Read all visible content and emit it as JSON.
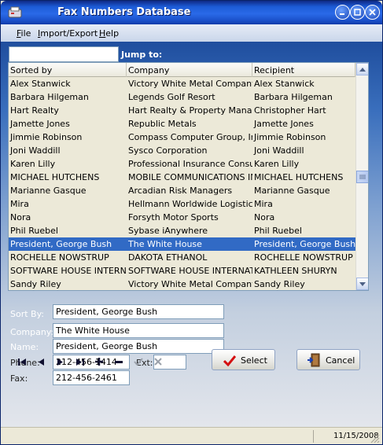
{
  "window": {
    "title": "Fax Numbers Database"
  },
  "menu": [
    {
      "underline": "F",
      "rest": "ile"
    },
    {
      "underline": "I",
      "rest": "mport/Export"
    },
    {
      "underline": "H",
      "rest": "elp"
    }
  ],
  "jump": {
    "label": "Jump to:",
    "value": ""
  },
  "grid": {
    "columns": [
      "Sorted by",
      "Company",
      "Recipient"
    ],
    "rows": [
      [
        "Alex Stanwick",
        "Victory White Metal Company",
        "Alex Stanwick"
      ],
      [
        "Barbara Hilgeman",
        "Legends Golf Resort",
        "Barbara Hilgeman"
      ],
      [
        "Hart Realty",
        "Hart Realty & Property Management",
        "Christopher Hart"
      ],
      [
        "Jamette Jones",
        "Republic Metals",
        "Jamette Jones"
      ],
      [
        "Jimmie Robinson",
        "Compass Computer Group, Inc.",
        "Jimmie Robinson"
      ],
      [
        "Joni Waddill",
        "Sysco Corporation",
        "Joni Waddill"
      ],
      [
        "Karen Lilly",
        "Professional Insurance Consultants",
        "Karen Lilly"
      ],
      [
        "MICHAEL HUTCHENS",
        "MOBILE COMMUNICATIONS INC.",
        "MICHAEL HUTCHENS"
      ],
      [
        "Marianne Gasque",
        "Arcadian Risk Managers",
        "Marianne Gasque"
      ],
      [
        "Mira",
        "Hellmann Worldwide Logistics",
        "Mira"
      ],
      [
        "Nora",
        "Forsyth Motor Sports",
        "Nora"
      ],
      [
        "Phil Ruebel",
        "Sybase iAnywhere",
        "Phil Ruebel"
      ],
      [
        "President, George Bush",
        "The White House",
        "President, George Bush"
      ],
      [
        "ROCHELLE NOWSTRUP",
        "DAKOTA ETHANOL",
        "ROCHELLE NOWSTRUP"
      ],
      [
        "SOFTWARE HOUSE INTERNATIONAL",
        "SOFTWARE HOUSE INTERNATIONAL",
        "KATHLEEN SHURYN"
      ],
      [
        "Sandy Riley",
        "Victory White Metal Company - C",
        "Sandy Riley"
      ]
    ],
    "selected_row": 12
  },
  "form": {
    "sort_by_label": "Sort By:",
    "sort_by_value": "President, George Bush",
    "company_label": "Company:",
    "company_value": "The White House",
    "name_label": "Name:",
    "name_value": "President, George Bush",
    "phone_label": "Phone:",
    "phone_value": "212-456-1414",
    "ext_label": "Ext:",
    "ext_value": "",
    "fax_label": "Fax:",
    "fax_value": "212-456-2461"
  },
  "navigator": {
    "first": "first-record-icon",
    "prior": "prior-record-icon",
    "next": "next-record-icon",
    "last": "last-record-icon",
    "insert": "insert-record-icon",
    "delete": "delete-record-icon",
    "post": "post-edit-icon",
    "cancel": "cancel-edit-icon"
  },
  "buttons": {
    "select": "Select",
    "cancel": "Cancel"
  },
  "status": {
    "date": "11/15/2008"
  },
  "colors": {
    "selection": "#316ac5",
    "title_bar": "#1c5bd6"
  }
}
